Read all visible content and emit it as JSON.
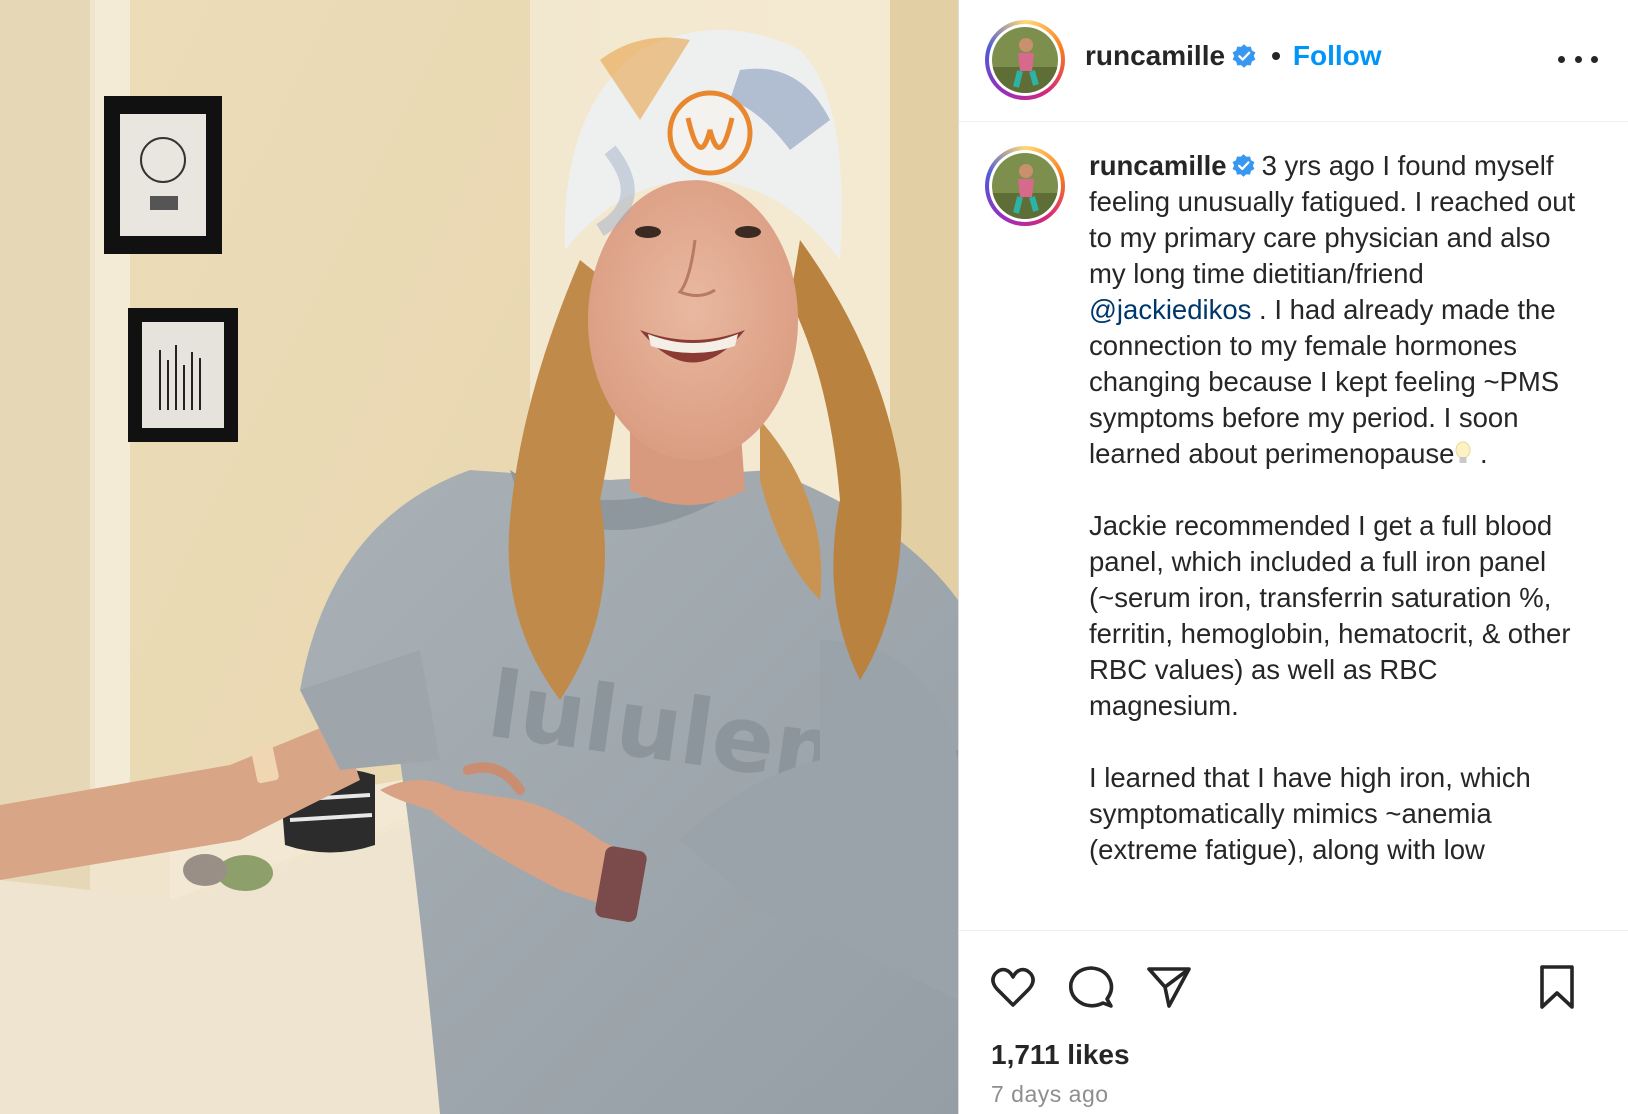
{
  "post": {
    "author": {
      "username": "runcamille",
      "verified": true
    },
    "header": {
      "separator": "•",
      "follow_label": "Follow",
      "more_icon": "more-horizontal-icon"
    },
    "caption": {
      "username": "runcamille",
      "paragraph1_before_mention": "3 yrs ago I found myself feeling unusually fatigued. I reached out to my primary care physician and also my long time dietitian/friend ",
      "mention": "@jackiedikos",
      "paragraph1_after_mention": " . I had already made the connection to my female hormones changing because I kept feeling ~PMS symptoms before my period. I soon learned about perimenopause",
      "paragraph1_end": " .",
      "paragraph2": "Jackie recommended I get a full blood panel, which included a full iron panel (~serum iron, transferrin saturation %, ferritin, hemoglobin, hematocrit, & other RBC values) as well as RBC magnesium.",
      "paragraph3": "I learned that I have high iron, which symptomatically mimics ~anemia (extreme fatigue), along with low"
    },
    "actions": {
      "like_icon": "heart-icon",
      "comment_icon": "comment-icon",
      "share_icon": "paper-plane-icon",
      "save_icon": "bookmark-icon"
    },
    "likes_text": "1,711 likes",
    "timestamp": "7 days ago",
    "photo": {
      "sweatshirt_text": "lululemon"
    },
    "colors": {
      "follow_blue": "#0095f6",
      "mention_blue": "#00376b",
      "verified_blue": "#3897f0",
      "muted_text": "#8e8e8e"
    }
  }
}
